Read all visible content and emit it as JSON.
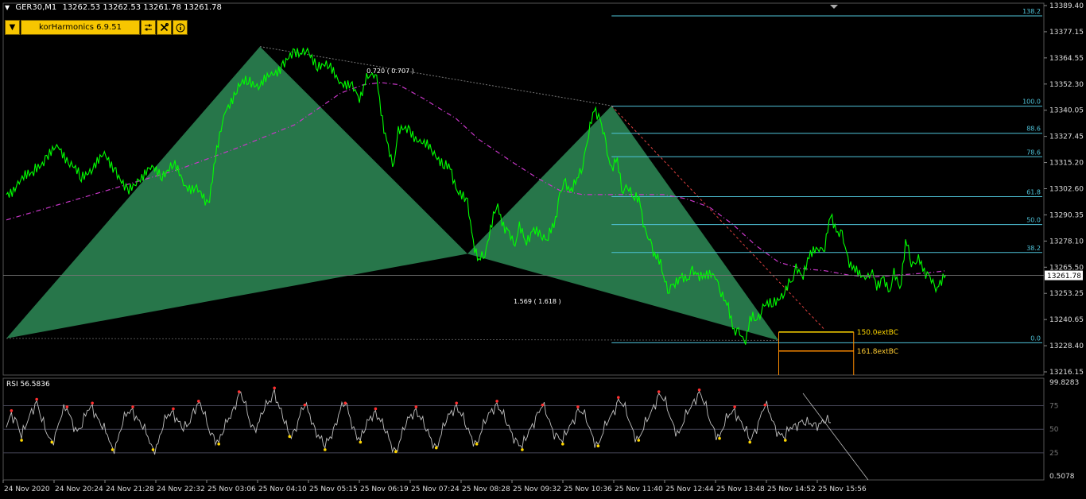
{
  "header": {
    "symbol": "GER30,M1",
    "ohlc": "13262.53 13262.53 13261.78 13261.78"
  },
  "toolbar": {
    "indicator_name": "korHarmonics 6.9.51"
  },
  "icons": [
    "dropdown-arrow-icon",
    "sliders-icon",
    "tools-icon",
    "info-icon"
  ],
  "colors": {
    "background": "#000000",
    "price": "#00ff00",
    "pattern_fill": "#2e8b57",
    "fib": "#4fc3d9",
    "ma": "#c837c8",
    "rsi_line": "#c0c0c0",
    "rsi_high": "#ff3030",
    "rsi_low": "#ffd700",
    "target": "#ffd700"
  },
  "chart_data": {
    "type": "line",
    "symbol": "GER30",
    "timeframe": "M1",
    "current_price": 13261.78,
    "current_price_label": "13261.78",
    "price_axis_labels": [
      "13389.40",
      "13377.15",
      "13364.55",
      "13352.30",
      "13340.05",
      "13327.45",
      "13315.20",
      "13302.60",
      "13290.35",
      "13278.10",
      "13265.50",
      "13253.25",
      "13240.65",
      "13228.40",
      "13216.15"
    ],
    "time_axis_labels": [
      "24 Nov 2020",
      "24 Nov 20:24",
      "24 Nov 21:28",
      "24 Nov 22:32",
      "25 Nov 03:06",
      "25 Nov 04:10",
      "25 Nov 05:15",
      "25 Nov 06:19",
      "25 Nov 07:24",
      "25 Nov 08:28",
      "25 Nov 09:32",
      "25 Nov 10:36",
      "25 Nov 11:40",
      "25 Nov 12:44",
      "25 Nov 13:48",
      "25 Nov 14:52",
      "25 Nov 15:56"
    ],
    "ylim": [
      13216.15,
      13389.4
    ],
    "price_path": [
      [
        0,
        13300
      ],
      [
        2,
        13305
      ],
      [
        5,
        13312
      ],
      [
        7,
        13318
      ],
      [
        9,
        13322
      ],
      [
        11,
        13316
      ],
      [
        13,
        13307
      ],
      [
        15,
        13314
      ],
      [
        17,
        13318
      ],
      [
        19,
        13312
      ],
      [
        21,
        13300
      ],
      [
        23,
        13308
      ],
      [
        25,
        13312
      ],
      [
        27,
        13310
      ],
      [
        29,
        13314
      ],
      [
        31,
        13305
      ],
      [
        33,
        13302
      ],
      [
        35,
        13295
      ],
      [
        36,
        13313
      ],
      [
        38,
        13340
      ],
      [
        40,
        13350
      ],
      [
        42,
        13354
      ],
      [
        44,
        13352
      ],
      [
        46,
        13356
      ],
      [
        48,
        13362
      ],
      [
        50,
        13366
      ],
      [
        51,
        13368
      ],
      [
        52,
        13368
      ],
      [
        54,
        13362
      ],
      [
        56,
        13360
      ],
      [
        58,
        13354
      ],
      [
        60,
        13350
      ],
      [
        61,
        13346
      ],
      [
        62,
        13350
      ],
      [
        63,
        13358
      ],
      [
        64,
        13358
      ],
      [
        65,
        13340
      ],
      [
        66,
        13325
      ],
      [
        67,
        13312
      ],
      [
        68,
        13330
      ],
      [
        70,
        13330
      ],
      [
        72,
        13325
      ],
      [
        74,
        13320
      ],
      [
        76,
        13315
      ],
      [
        77,
        13312
      ],
      [
        78,
        13303
      ],
      [
        80,
        13295
      ],
      [
        81,
        13278
      ],
      [
        82,
        13268
      ],
      [
        83,
        13273
      ],
      [
        85,
        13294
      ],
      [
        86,
        13288
      ],
      [
        87,
        13282
      ],
      [
        88,
        13276
      ],
      [
        89,
        13284
      ],
      [
        90,
        13278
      ],
      [
        91,
        13282
      ],
      [
        93,
        13281
      ],
      [
        94,
        13280
      ],
      [
        95,
        13285
      ],
      [
        96,
        13300
      ],
      [
        97,
        13305
      ],
      [
        98,
        13302
      ],
      [
        99,
        13307
      ],
      [
        100,
        13315
      ],
      [
        101,
        13328
      ],
      [
        102,
        13342
      ],
      [
        103,
        13334
      ],
      [
        104,
        13325
      ],
      [
        105,
        13310
      ],
      [
        106,
        13318
      ],
      [
        107,
        13300
      ],
      [
        108,
        13305
      ],
      [
        109,
        13298
      ],
      [
        110,
        13296
      ],
      [
        111,
        13280
      ],
      [
        112,
        13275
      ],
      [
        113,
        13270
      ],
      [
        114,
        13262
      ],
      [
        115,
        13255
      ],
      [
        116,
        13258
      ],
      [
        117,
        13262
      ],
      [
        118,
        13258
      ],
      [
        119,
        13265
      ],
      [
        120,
        13260
      ],
      [
        121,
        13263
      ],
      [
        123,
        13260
      ],
      [
        124,
        13255
      ],
      [
        125,
        13248
      ],
      [
        126,
        13238
      ],
      [
        127,
        13234
      ],
      [
        128,
        13230
      ],
      [
        129,
        13240
      ],
      [
        130,
        13242
      ],
      [
        131,
        13245
      ],
      [
        133,
        13250
      ],
      [
        135,
        13253
      ],
      [
        136,
        13258
      ],
      [
        137,
        13265
      ],
      [
        138,
        13260
      ],
      [
        139,
        13270
      ],
      [
        141,
        13274
      ],
      [
        142,
        13276
      ],
      [
        143,
        13290
      ],
      [
        144,
        13283
      ],
      [
        145,
        13280
      ],
      [
        146,
        13270
      ],
      [
        147,
        13264
      ],
      [
        149,
        13262
      ],
      [
        150,
        13263
      ],
      [
        151,
        13258
      ],
      [
        152,
        13260
      ],
      [
        153,
        13254
      ],
      [
        154,
        13262
      ],
      [
        155,
        13255
      ],
      [
        156,
        13278
      ],
      [
        157,
        13268
      ],
      [
        158,
        13270
      ],
      [
        159,
        13265
      ],
      [
        160,
        13262
      ],
      [
        161,
        13255
      ],
      [
        162,
        13258
      ],
      [
        163,
        13262
      ]
    ],
    "ma_path": [
      [
        0,
        13288
      ],
      [
        10,
        13296
      ],
      [
        20,
        13304
      ],
      [
        30,
        13312
      ],
      [
        40,
        13322
      ],
      [
        50,
        13333
      ],
      [
        58,
        13348
      ],
      [
        62,
        13352
      ],
      [
        65,
        13353
      ],
      [
        68,
        13352
      ],
      [
        72,
        13346
      ],
      [
        78,
        13336
      ],
      [
        82,
        13326
      ],
      [
        88,
        13315
      ],
      [
        92,
        13308
      ],
      [
        96,
        13302
      ],
      [
        100,
        13300
      ],
      [
        104,
        13300
      ],
      [
        110,
        13300
      ],
      [
        114,
        13300
      ],
      [
        118,
        13298
      ],
      [
        122,
        13294
      ],
      [
        126,
        13286
      ],
      [
        130,
        13276
      ],
      [
        134,
        13268
      ],
      [
        138,
        13265
      ],
      [
        142,
        13264
      ],
      [
        146,
        13262
      ],
      [
        150,
        13261
      ],
      [
        155,
        13262
      ],
      [
        160,
        13263
      ],
      [
        163,
        13264
      ]
    ],
    "harmonic_pattern": {
      "points": [
        [
          0,
          13232
        ],
        [
          44,
          13370
        ],
        [
          80,
          13272
        ],
        [
          105,
          13342
        ],
        [
          134,
          13231
        ]
      ],
      "ratio_label_xb": "0.720 ( 0.707 )",
      "ratio_label_bd": "1.569 ( 1.618 )"
    },
    "fib_levels": [
      {
        "label": "138.2",
        "price": 13384.5
      },
      {
        "label": "100.0",
        "price": 13341.8
      },
      {
        "label": "88.6",
        "price": 13329.0
      },
      {
        "label": "78.6",
        "price": 13317.9
      },
      {
        "label": "61.8",
        "price": 13299.0
      },
      {
        "label": "50.0",
        "price": 13285.8
      },
      {
        "label": "38.2",
        "price": 13272.6
      },
      {
        "label": "0.0",
        "price": 13229.9
      }
    ],
    "targets": [
      {
        "label": "150.0extBC",
        "price": 13235.0
      },
      {
        "label": "161.8extBC",
        "price": 13226.0
      }
    ],
    "rsi": {
      "label": "RSI 56.5836",
      "value": 56.5836,
      "axis_labels": [
        "99.8283",
        "75",
        "50",
        "25",
        "0.5078"
      ],
      "levels": [
        75,
        50,
        25
      ],
      "ylim": [
        0.5078,
        99.8283
      ],
      "values": [
        52,
        68,
        60,
        40,
        55,
        72,
        80,
        58,
        45,
        38,
        50,
        65,
        72,
        60,
        48,
        52,
        70,
        76,
        62,
        50,
        44,
        30,
        38,
        55,
        68,
        72,
        60,
        50,
        42,
        30,
        35,
        52,
        66,
        70,
        58,
        48,
        55,
        72,
        78,
        66,
        50,
        44,
        36,
        48,
        62,
        74,
        88,
        78,
        60,
        52,
        58,
        70,
        80,
        92,
        72,
        56,
        44,
        50,
        64,
        74,
        66,
        52,
        40,
        30,
        42,
        56,
        70,
        76,
        62,
        48,
        38,
        50,
        64,
        70,
        58,
        46,
        36,
        28,
        40,
        54,
        66,
        72,
        60,
        48,
        40,
        32,
        44,
        58,
        70,
        76,
        64,
        50,
        42,
        36,
        48,
        60,
        72,
        78,
        66,
        54,
        46,
        38,
        30,
        42,
        56,
        68,
        74,
        62,
        50,
        44,
        36,
        48,
        60,
        72,
        66,
        54,
        42,
        34,
        46,
        58,
        70,
        82,
        74,
        60,
        48,
        40,
        50,
        62,
        76,
        88,
        80,
        66,
        54,
        46,
        58,
        70,
        82,
        90,
        76,
        60,
        50,
        42,
        54,
        66,
        72,
        60,
        48,
        38,
        50,
        62,
        74,
        66,
        54,
        44,
        40,
        52,
        56,
        58,
        54,
        56,
        57,
        56,
        57,
        57
      ]
    }
  }
}
